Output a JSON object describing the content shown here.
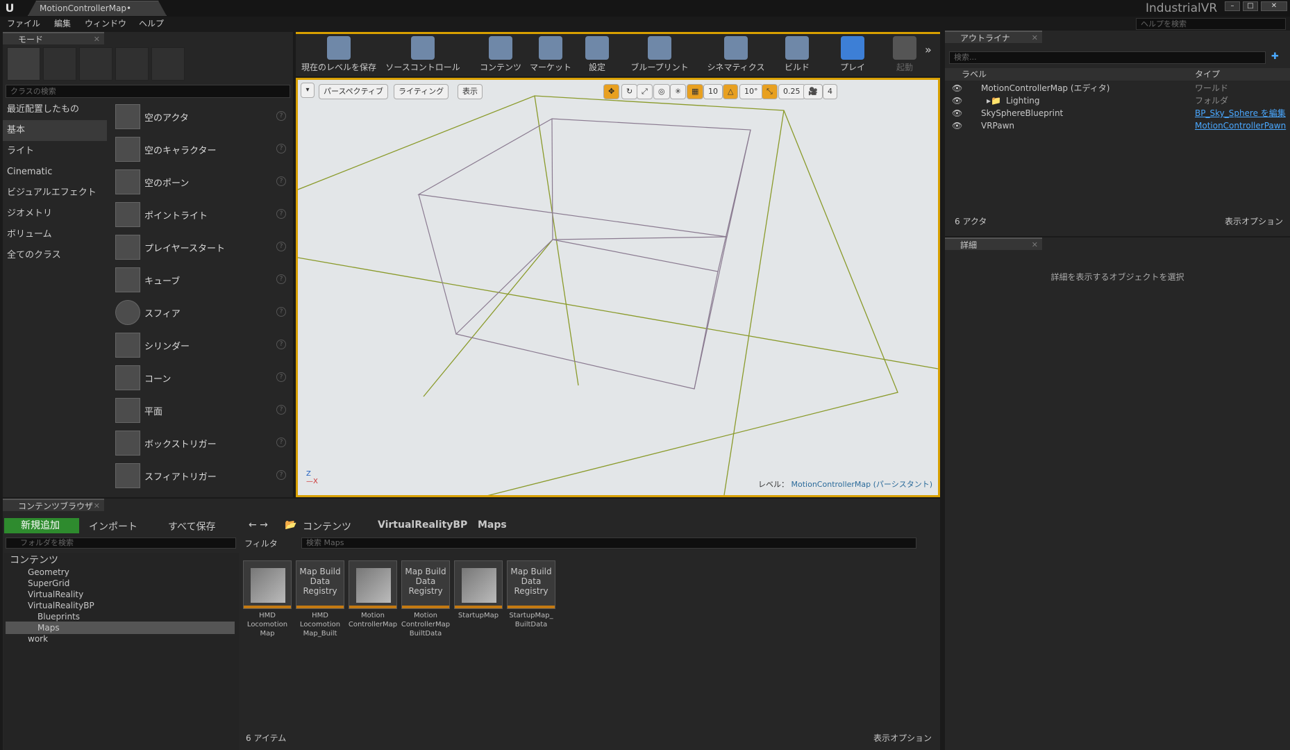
{
  "window": {
    "doc_tab": "MotionControllerMap•",
    "project": "IndustrialVR"
  },
  "menu": [
    "ファイル",
    "編集",
    "ウィンドウ",
    "ヘルプ"
  ],
  "help_search": {
    "placeholder": "ヘルプを検索"
  },
  "modes": {
    "tab": "モード",
    "search_placeholder": "クラスの検索",
    "categories": [
      "最近配置したもの",
      "基本",
      "ライト",
      "Cinematic",
      "ビジュアルエフェクト",
      "ジオメトリ",
      "ボリューム",
      "全てのクラス"
    ],
    "selected_category": "基本",
    "actors": [
      "空のアクタ",
      "空のキャラクター",
      "空のポーン",
      "ポイントライト",
      "プレイヤースタート",
      "キューブ",
      "スフィア",
      "シリンダー",
      "コーン",
      "平面",
      "ボックストリガー",
      "スフィアトリガー"
    ]
  },
  "toolbar": [
    "現在のレベルを保存",
    "ソースコントロール",
    "コンテンツ",
    "マーケット",
    "設定",
    "ブループリント",
    "シネマティクス",
    "ビルド",
    "プレイ",
    "起動"
  ],
  "viewport": {
    "perspective": "パースペクティブ",
    "lighting": "ライティング",
    "show": "表示",
    "grid": "10",
    "rotation": "10°",
    "scale": "0.25",
    "camera_speed": "4",
    "level_label": "レベル：",
    "level_name": "MotionControllerMap (パーシスタント)"
  },
  "outliner": {
    "tab": "アウトライナ",
    "search_placeholder": "検索...",
    "col_label": "ラベル",
    "col_type": "タイプ",
    "rows": [
      {
        "label": "MotionControllerMap (エディタ)",
        "type": "ワールド"
      },
      {
        "label": "Lighting",
        "type": "フォルダ"
      },
      {
        "label": "SkySphereBlueprint",
        "type": "BP_Sky_Sphere を編集"
      },
      {
        "label": "VRPawn",
        "type": "MotionControllerPawn"
      }
    ],
    "count": "6 アクタ",
    "view_options": "表示オプション"
  },
  "details": {
    "tab": "詳細",
    "empty": "詳細を表示するオブジェクトを選択"
  },
  "content": {
    "tab": "コンテンツブラウザ",
    "add_new": "新規追加",
    "import": "インポート",
    "save_all": "すべて保存",
    "path": [
      "コンテンツ",
      "VirtualRealityBP",
      "Maps"
    ],
    "folder_search": "フォルダを検索",
    "filter": "フィルタ",
    "asset_search": "検索 Maps",
    "tree": [
      "コンテンツ",
      "Geometry",
      "SuperGrid",
      "VirtualReality",
      "VirtualRealityBP",
      "Blueprints",
      "Maps",
      "work"
    ],
    "assets": [
      {
        "thumb": "",
        "name": "HMD Locomotion Map"
      },
      {
        "thumb": "Map Build Data Registry",
        "name": "HMD Locomotion Map_Built"
      },
      {
        "thumb": "",
        "name": "Motion ControllerMap"
      },
      {
        "thumb": "Map Build Data Registry",
        "name": "Motion ControllerMap BuiltData"
      },
      {
        "thumb": "",
        "name": "StartupMap"
      },
      {
        "thumb": "Map Build Data Registry",
        "name": "StartupMap_ BuiltData"
      }
    ],
    "count": "6 アイテム",
    "view_options": "表示オプション"
  },
  "colors": {
    "accent": "#d8a000",
    "panel": "#262626",
    "viewport_bg": "#e3e6e8",
    "link": "#4aa8ff"
  }
}
